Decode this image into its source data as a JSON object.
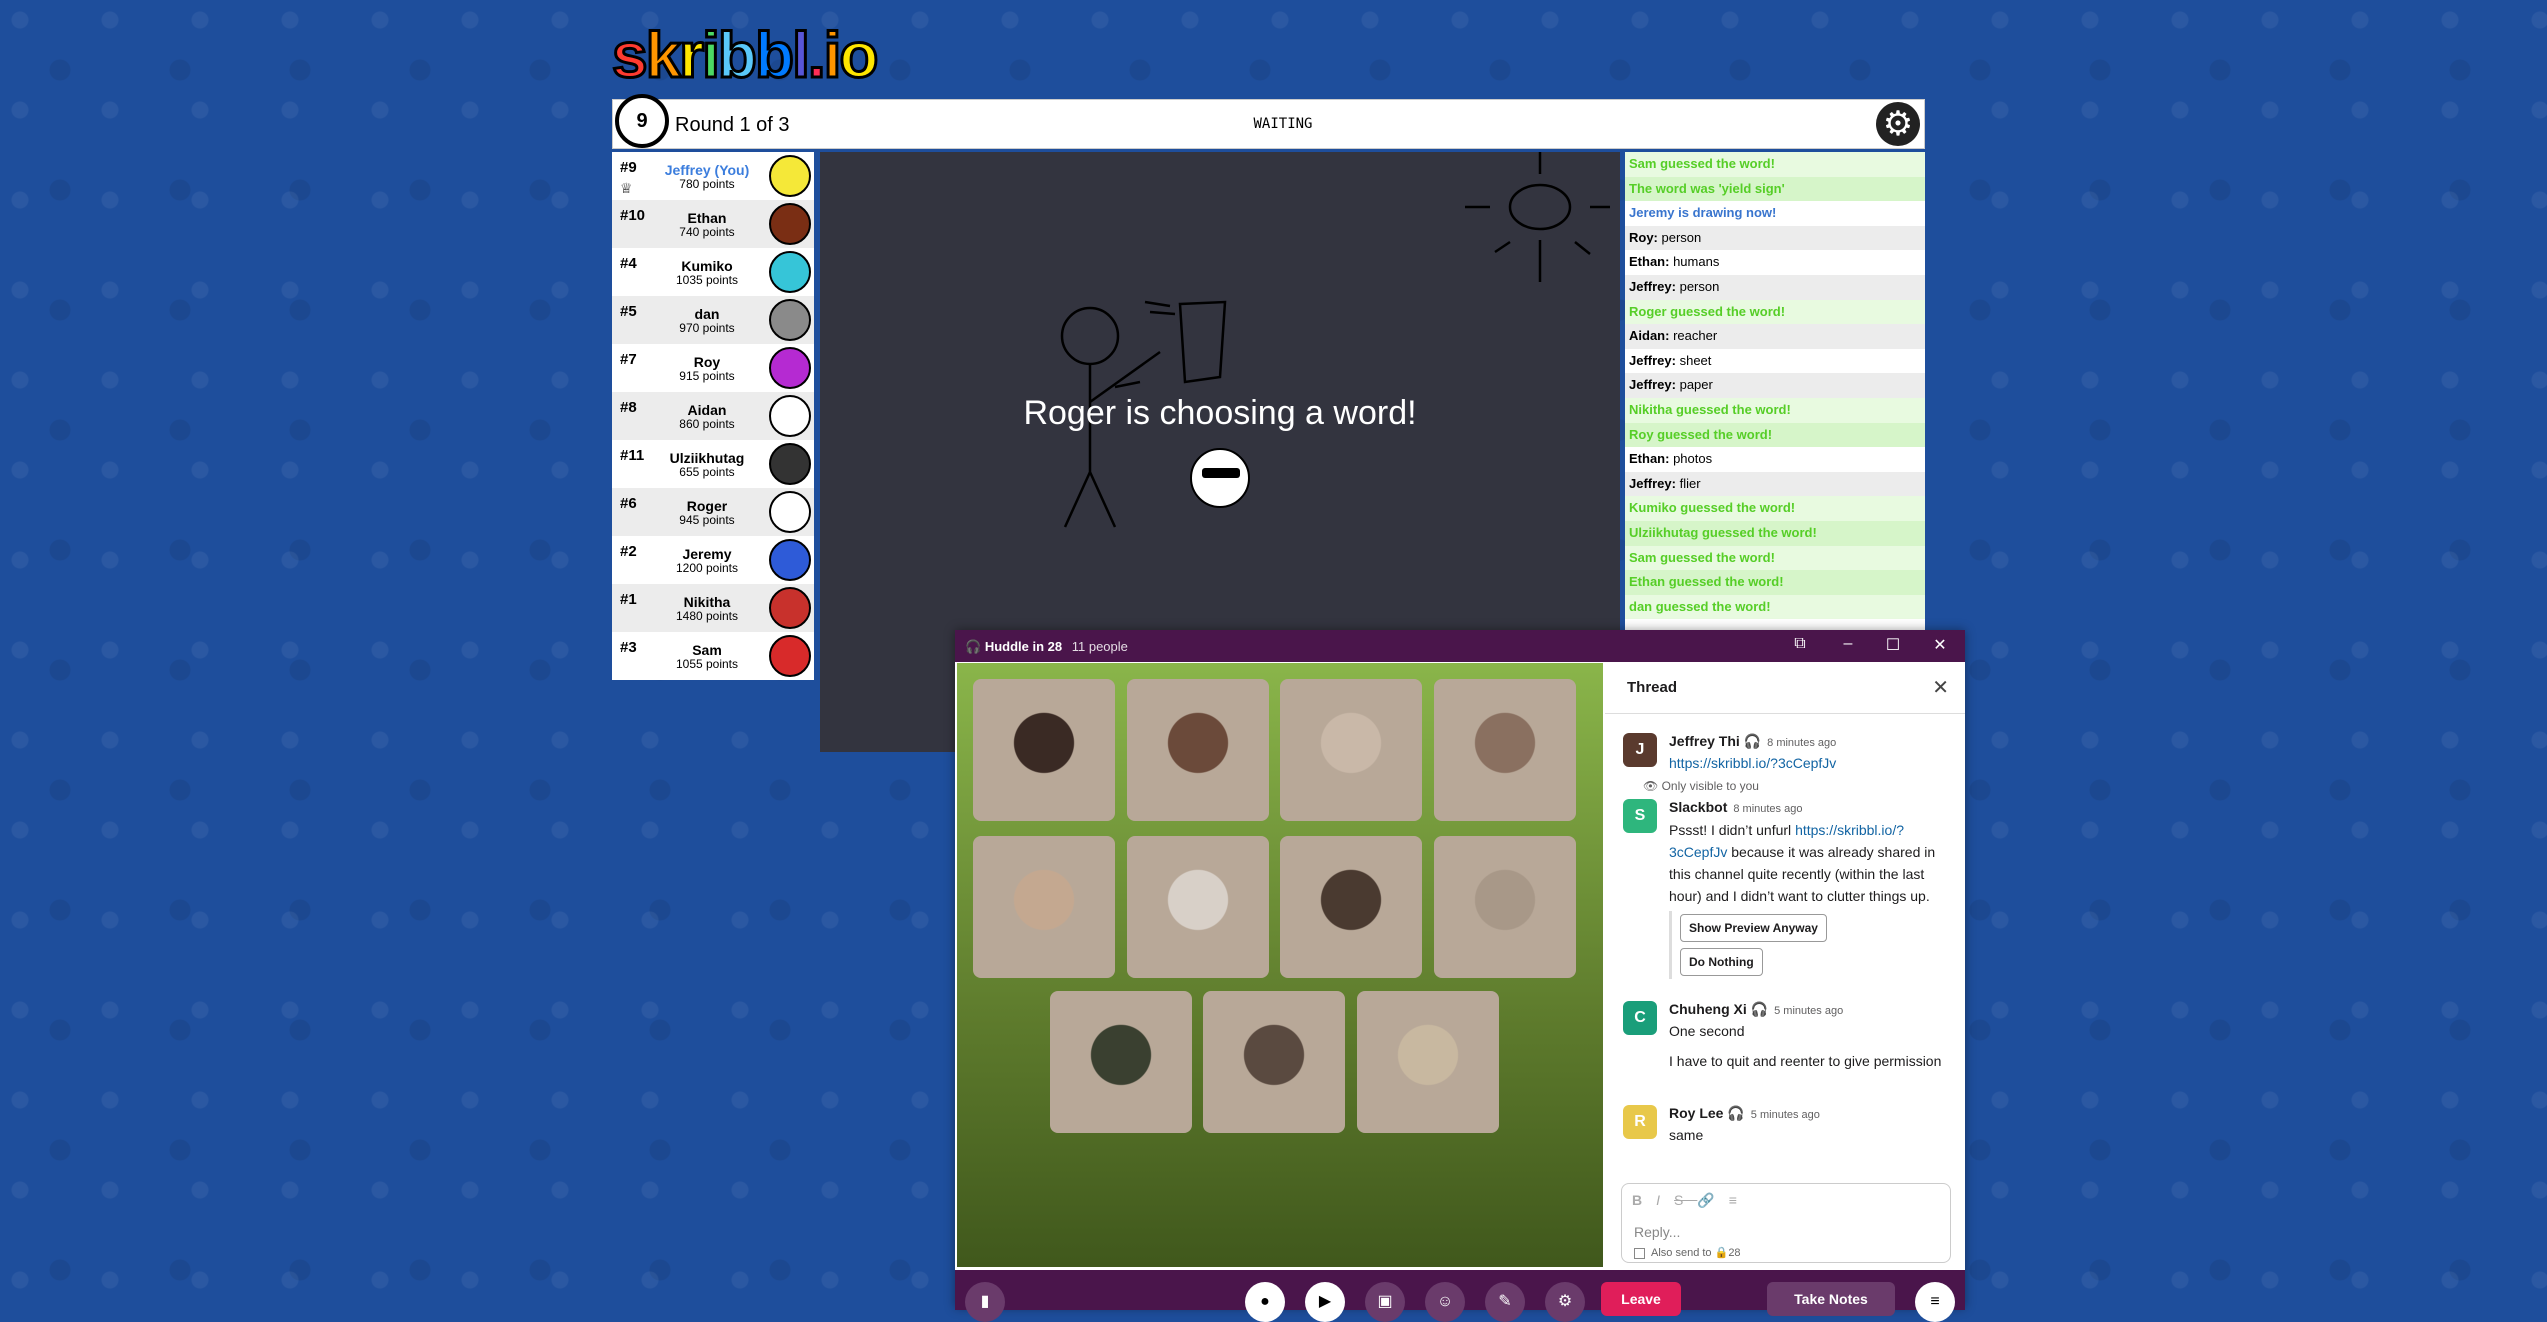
{
  "game": {
    "logo_text": "skribbl.io",
    "timer": "9",
    "round": "Round 1 of 3",
    "status": "WAITING",
    "choosing_text": "Roger is choosing a word!",
    "players": [
      {
        "rank": "#9",
        "name": "Jeffrey (You)",
        "points": "780 points",
        "me": true,
        "color": "#f5e838"
      },
      {
        "rank": "#10",
        "name": "Ethan",
        "points": "740 points",
        "color": "#7a2e14"
      },
      {
        "rank": "#4",
        "name": "Kumiko",
        "points": "1035 points",
        "color": "#36c5d8"
      },
      {
        "rank": "#5",
        "name": "dan",
        "points": "970 points",
        "color": "#8a8a8a"
      },
      {
        "rank": "#7",
        "name": "Roy",
        "points": "915 points",
        "color": "#b52ad2"
      },
      {
        "rank": "#8",
        "name": "Aidan",
        "points": "860 points",
        "color": "#ffffff"
      },
      {
        "rank": "#11",
        "name": "Ulziikhutag",
        "points": "655 points",
        "color": "#333333"
      },
      {
        "rank": "#6",
        "name": "Roger",
        "points": "945 points",
        "color": "#ffffff"
      },
      {
        "rank": "#2",
        "name": "Jeremy",
        "points": "1200 points",
        "color": "#2e5bd8"
      },
      {
        "rank": "#1",
        "name": "Nikitha",
        "points": "1480 points",
        "color": "#c8312c"
      },
      {
        "rank": "#3",
        "name": "Sam",
        "points": "1055 points",
        "color": "#d82a2a"
      }
    ],
    "chat": [
      {
        "type": "guess",
        "who": "",
        "text": "Sam guessed the word!"
      },
      {
        "type": "guess",
        "who": "",
        "text": "The word was 'yield sign'"
      },
      {
        "type": "draw",
        "who": "",
        "text": "Jeremy is drawing now!"
      },
      {
        "type": "msg",
        "who": "Roy:",
        "text": "person"
      },
      {
        "type": "msg",
        "who": "Ethan:",
        "text": "humans"
      },
      {
        "type": "msg",
        "who": "Jeffrey:",
        "text": "person"
      },
      {
        "type": "guess",
        "who": "",
        "text": "Roger guessed the word!"
      },
      {
        "type": "msg",
        "who": "Aidan:",
        "text": "reacher"
      },
      {
        "type": "msg",
        "who": "Jeffrey:",
        "text": "sheet"
      },
      {
        "type": "msg",
        "who": "Jeffrey:",
        "text": "paper"
      },
      {
        "type": "guess",
        "who": "",
        "text": "Nikitha guessed the word!"
      },
      {
        "type": "guess",
        "who": "",
        "text": "Roy guessed the word!"
      },
      {
        "type": "msg",
        "who": "Ethan:",
        "text": "photos"
      },
      {
        "type": "msg",
        "who": "Jeffrey:",
        "text": "flier"
      },
      {
        "type": "guess",
        "who": "",
        "text": "Kumiko guessed the word!"
      },
      {
        "type": "guess",
        "who": "",
        "text": "Ulziikhutag guessed the word!"
      },
      {
        "type": "guess",
        "who": "",
        "text": "Sam guessed the word!"
      },
      {
        "type": "guess",
        "who": "",
        "text": "Ethan guessed the word!"
      },
      {
        "type": "guess",
        "who": "",
        "text": "dan guessed the word!"
      }
    ]
  },
  "huddle": {
    "title": "Huddle in 28",
    "people": "11 people",
    "tile_colors": [
      "#3a2a24",
      "#6b4a3a",
      "#c9b8a8",
      "#8a7060",
      "#c4a890",
      "#d8d0c8",
      "#4a3a30",
      "#a89888",
      "#3a4030",
      "#5a4a40",
      "#c8b8a0"
    ],
    "leave_label": "Leave",
    "notes_label": "Take Notes"
  },
  "thread": {
    "title": "Thread",
    "messages": [
      {
        "avatar": "J",
        "avatar_color": "#5a3a2e",
        "name": "Jeffrey Thi",
        "time": "8 minutes ago",
        "body": "https://skribbl.io/?3cCepfJv"
      },
      {
        "avatar": "S",
        "avatar_color": "#2eb67d",
        "name": "Slackbot",
        "time": "8 minutes ago",
        "visible_note": "Only visible to you",
        "body_pre": "Pssst! I didn’t unfurl ",
        "body_link": "https://skribbl.io/?3cCepfJv",
        "body_post": " because it was already shared in this channel quite recently (within the last hour) and I didn’t want to clutter things up.",
        "btn1": "Show Preview Anyway",
        "btn2": "Do Nothing"
      },
      {
        "avatar": "C",
        "avatar_color": "#1a9e7a",
        "name": "Chuheng Xi",
        "time": "5 minutes ago",
        "body": "One second",
        "body2": "I have to quit and reenter to give permission"
      },
      {
        "avatar": "R",
        "avatar_color": "#e8c84a",
        "name": "Roy Lee",
        "time": "5 minutes ago",
        "body": "same"
      }
    ],
    "reply_placeholder": "Reply...",
    "also_send": "Also send to",
    "channel": "28"
  }
}
